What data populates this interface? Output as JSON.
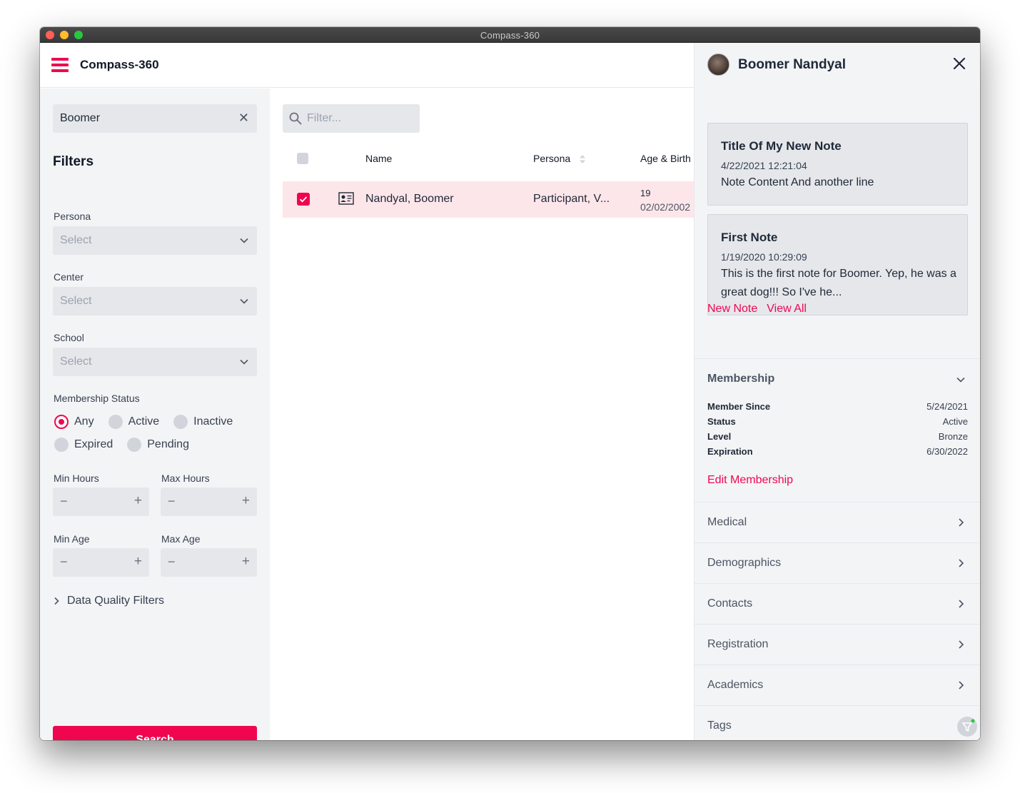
{
  "window": {
    "title": "Compass-360"
  },
  "header": {
    "app_name": "Compass-360"
  },
  "sidebar": {
    "search_value": "Boomer",
    "filters_title": "Filters",
    "persona": {
      "label": "Persona",
      "placeholder": "Select"
    },
    "center": {
      "label": "Center",
      "placeholder": "Select"
    },
    "school": {
      "label": "School",
      "placeholder": "Select"
    },
    "membership_status": {
      "label": "Membership Status",
      "options": [
        "Any",
        "Active",
        "Inactive",
        "Expired",
        "Pending"
      ],
      "selected": "Any"
    },
    "min_hours": {
      "label": "Min Hours"
    },
    "max_hours": {
      "label": "Max Hours"
    },
    "min_age": {
      "label": "Min Age"
    },
    "max_age": {
      "label": "Max Age"
    },
    "data_quality_filters": "Data Quality Filters",
    "search_button": "Search"
  },
  "main": {
    "filter_placeholder": "Filter...",
    "columns": {
      "name": "Name",
      "persona": "Persona",
      "age_birth": "Age & Birth"
    },
    "rows": [
      {
        "name": "Nandyal, Boomer",
        "persona": "Participant, V...",
        "age": "19",
        "birth": "02/02/2002",
        "selected": true
      }
    ]
  },
  "panel": {
    "name": "Boomer Nandyal",
    "notes": [
      {
        "title": "Title Of My New Note",
        "date": "4/22/2021 12:21:04",
        "body": "Note Content And another line"
      },
      {
        "title": "First Note",
        "date": "1/19/2020 10:29:09",
        "body": "This is the first note for Boomer. Yep, he was a great dog!!! So I've he..."
      }
    ],
    "new_note": "New Note",
    "view_all": "View All",
    "membership": {
      "title": "Membership",
      "fields": [
        {
          "label": "Member Since",
          "value": "5/24/2021"
        },
        {
          "label": "Status",
          "value": "Active"
        },
        {
          "label": "Level",
          "value": "Bronze"
        },
        {
          "label": "Expiration",
          "value": "6/30/2022"
        }
      ],
      "edit_link": "Edit Membership"
    },
    "sections": [
      "Medical",
      "Demographics",
      "Contacts",
      "Registration",
      "Academics",
      "Tags"
    ]
  },
  "colors": {
    "accent": "#f0064e",
    "selected_row": "#fde6ea",
    "panel_bg": "#f3f4f6"
  }
}
